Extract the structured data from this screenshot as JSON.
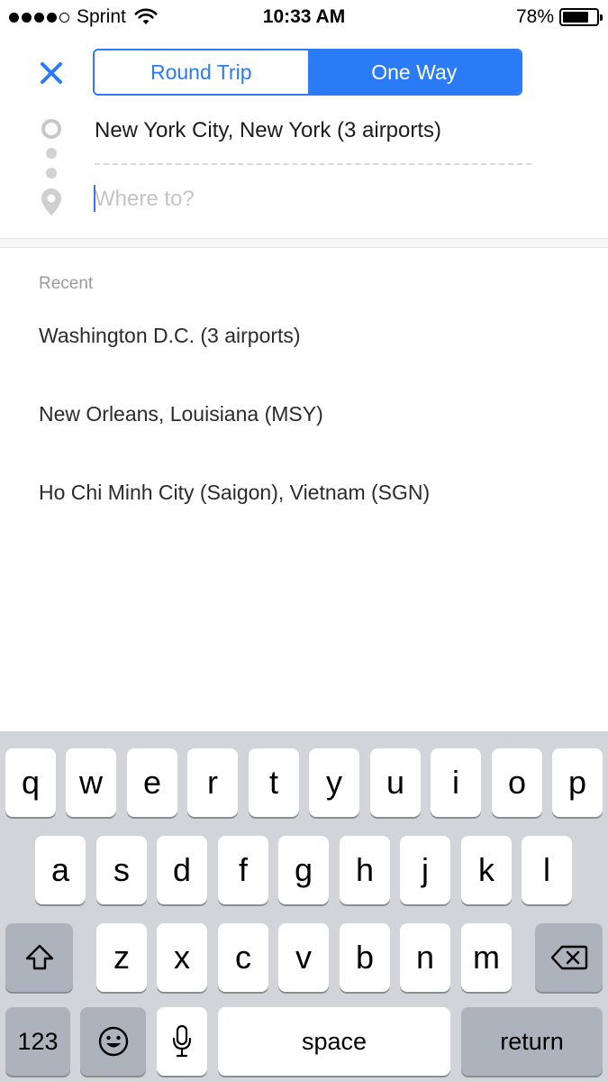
{
  "status_bar": {
    "carrier": "Sprint",
    "time": "10:33 AM",
    "battery_percent": "78%",
    "battery_level": 0.78,
    "signal_bars": 4,
    "signal_max": 5
  },
  "header": {
    "close_icon": "close-x-icon",
    "trip_types": [
      {
        "label": "Round Trip",
        "selected": false
      },
      {
        "label": "One Way",
        "selected": true
      }
    ]
  },
  "route": {
    "origin": "New York City, New York (3 airports)",
    "destination_value": "",
    "destination_placeholder": "Where to?"
  },
  "recent": {
    "heading": "Recent",
    "items": [
      "Washington D.C. (3 airports)",
      "New Orleans, Louisiana (MSY)",
      "Ho Chi Minh City (Saigon), Vietnam (SGN)"
    ]
  },
  "keyboard": {
    "row1": [
      "q",
      "w",
      "e",
      "r",
      "t",
      "y",
      "u",
      "i",
      "o",
      "p"
    ],
    "row2": [
      "a",
      "s",
      "d",
      "f",
      "g",
      "h",
      "j",
      "k",
      "l"
    ],
    "row3": [
      "z",
      "x",
      "c",
      "v",
      "b",
      "n",
      "m"
    ],
    "numbers_key": "123",
    "space_key": "space",
    "return_key": "return",
    "shift_icon": "shift-arrow-icon",
    "delete_icon": "backspace-icon",
    "emoji_icon": "emoji-face-icon",
    "mic_icon": "microphone-icon"
  },
  "colors": {
    "accent": "#2a7bf5",
    "keyboard_bg": "#d1d4d9",
    "function_key": "#adb3bc"
  }
}
